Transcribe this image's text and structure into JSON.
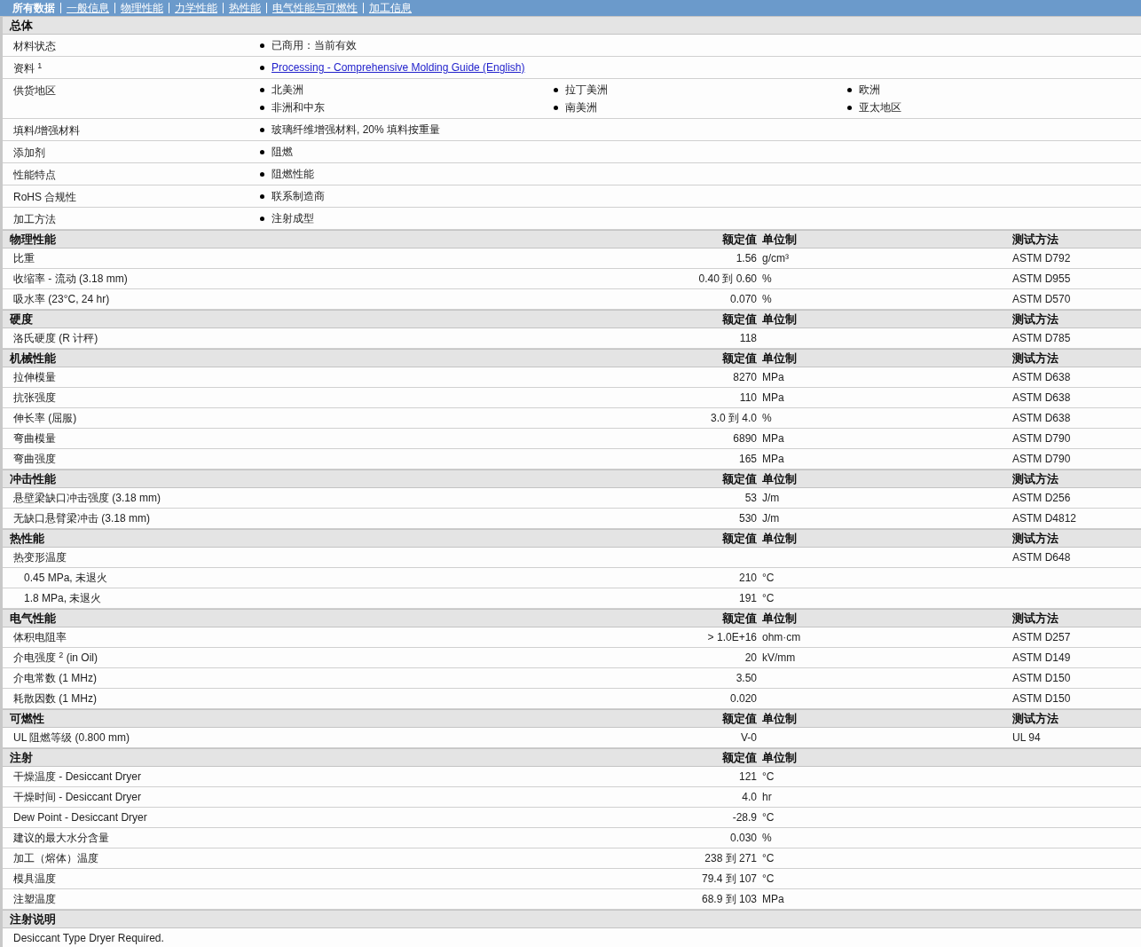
{
  "nav": [
    {
      "label": "所有数据",
      "selected": true
    },
    {
      "label": "一般信息",
      "selected": false
    },
    {
      "label": "物理性能",
      "selected": false
    },
    {
      "label": "力学性能",
      "selected": false
    },
    {
      "label": "热性能",
      "selected": false
    },
    {
      "label": "电气性能与可燃性",
      "selected": false
    },
    {
      "label": "加工信息",
      "selected": false
    }
  ],
  "general": {
    "title": "总体",
    "rows": [
      {
        "label": "材料状态",
        "items": [
          {
            "kind": "text",
            "text": "已商用：当前有效"
          }
        ]
      },
      {
        "label": "资料 $^{1}$",
        "items": [
          {
            "kind": "link",
            "text": "Processing - Comprehensive Molding Guide (English)"
          }
        ]
      },
      {
        "label": "供货地区",
        "items": [
          {
            "kind": "text",
            "text": "北美洲"
          },
          {
            "kind": "text",
            "text": "拉丁美洲"
          },
          {
            "kind": "text",
            "text": "欧洲"
          },
          {
            "kind": "text",
            "text": "非洲和中东"
          },
          {
            "kind": "text",
            "text": "南美洲"
          },
          {
            "kind": "text",
            "text": "亚太地区"
          }
        ]
      },
      {
        "label": "填料/增强材料",
        "items": [
          {
            "kind": "text",
            "text": "玻璃纤维增强材料, 20% 填料按重量"
          }
        ]
      },
      {
        "label": "添加剂",
        "items": [
          {
            "kind": "text",
            "text": "阻燃"
          }
        ]
      },
      {
        "label": "性能特点",
        "items": [
          {
            "kind": "text",
            "text": "阻燃性能"
          }
        ]
      },
      {
        "label": "RoHS 合规性",
        "items": [
          {
            "kind": "text",
            "text": "联系制造商"
          }
        ]
      },
      {
        "label": "加工方法",
        "items": [
          {
            "kind": "text",
            "text": "注射成型"
          }
        ]
      }
    ]
  },
  "sections": [
    {
      "title": "物理性能",
      "headers": {
        "value": "额定值",
        "unit": "单位制",
        "method": "测试方法"
      },
      "rows": [
        {
          "label": "比重",
          "value": "1.56",
          "unit": "g/cm³",
          "method": "ASTM D792"
        },
        {
          "label": "收缩率 - 流动 (3.18 mm)",
          "value": "0.40 到 0.60",
          "unit": "%",
          "method": "ASTM D955"
        },
        {
          "label": "吸水率 (23°C, 24 hr)",
          "value": "0.070",
          "unit": "%",
          "method": "ASTM D570"
        }
      ]
    },
    {
      "title": "硬度",
      "headers": {
        "value": "额定值",
        "unit": "单位制",
        "method": "测试方法"
      },
      "rows": [
        {
          "label": "洛氏硬度 (R 计秤)",
          "value": "118",
          "method": "ASTM D785"
        }
      ]
    },
    {
      "title": "机械性能",
      "headers": {
        "value": "额定值",
        "unit": "单位制",
        "method": "测试方法"
      },
      "rows": [
        {
          "label": "拉伸模量",
          "value": "8270",
          "unit": "MPa",
          "method": "ASTM D638"
        },
        {
          "label": "抗张强度",
          "value": "110",
          "unit": "MPa",
          "method": "ASTM D638"
        },
        {
          "label": "伸长率 (屈服)",
          "value": "3.0 到 4.0",
          "unit": "%",
          "method": "ASTM D638"
        },
        {
          "label": "弯曲模量",
          "value": "6890",
          "unit": "MPa",
          "method": "ASTM D790"
        },
        {
          "label": "弯曲强度",
          "value": "165",
          "unit": "MPa",
          "method": "ASTM D790"
        }
      ]
    },
    {
      "title": "冲击性能",
      "headers": {
        "value": "额定值",
        "unit": "单位制",
        "method": "测试方法"
      },
      "rows": [
        {
          "label": "悬壁梁缺口冲击强度 (3.18 mm)",
          "value": "53",
          "unit": "J/m",
          "method": "ASTM D256"
        },
        {
          "label": "无缺口悬臂梁冲击 (3.18 mm)",
          "value": "530",
          "unit": "J/m",
          "method": "ASTM D4812"
        }
      ]
    },
    {
      "title": "热性能",
      "headers": {
        "value": "额定值",
        "unit": "单位制",
        "method": "测试方法"
      },
      "rows": [
        {
          "label": "热变形温度",
          "method": "ASTM D648",
          "children": [
            {
              "label": "0.45 MPa, 未退火",
              "value": "210",
              "unit": "°C"
            },
            {
              "label": "1.8 MPa, 未退火",
              "value": "191",
              "unit": "°C"
            }
          ]
        }
      ]
    },
    {
      "title": "电气性能",
      "headers": {
        "value": "额定值",
        "unit": "单位制",
        "method": "测试方法"
      },
      "rows": [
        {
          "label": "体积电阻率",
          "value": "> 1.0E+16",
          "unit": "ohm·cm",
          "method": "ASTM D257"
        },
        {
          "label": "介电强度 $^{2}$ (in Oil)",
          "value": "20",
          "unit": "kV/mm",
          "method": "ASTM D149"
        },
        {
          "label": "介电常数 (1 MHz)",
          "value": "3.50",
          "method": "ASTM D150"
        },
        {
          "label": "耗散因数 (1 MHz)",
          "value": "0.020",
          "method": "ASTM D150"
        }
      ]
    },
    {
      "title": "可燃性",
      "headers": {
        "value": "额定值",
        "unit": "单位制",
        "method": "测试方法"
      },
      "rows": [
        {
          "label": "UL 阻燃等级 (0.800 mm)",
          "value": "V-0",
          "method": "UL 94"
        }
      ]
    },
    {
      "title": "注射",
      "headers": {
        "value": "额定值",
        "unit": "单位制"
      },
      "rows": [
        {
          "label": "干燥温度 - Desiccant Dryer",
          "value": "121",
          "unit": "°C"
        },
        {
          "label": "干燥时间 - Desiccant Dryer",
          "value": "4.0",
          "unit": "hr"
        },
        {
          "label": "Dew Point - Desiccant Dryer",
          "value": "-28.9",
          "unit": "°C"
        },
        {
          "label": "建议的最大水分含量",
          "value": "0.030",
          "unit": "%"
        },
        {
          "label": "加工（熔体）温度",
          "value": "238 到 271",
          "unit": "°C"
        },
        {
          "label": "模具温度",
          "value": "79.4 到 107",
          "unit": "°C"
        },
        {
          "label": "注塑温度",
          "value": "68.9 到 103",
          "unit": "MPa"
        }
      ]
    }
  ],
  "notes": {
    "title": "注射说明",
    "text": "Desiccant Type Dryer Required."
  }
}
